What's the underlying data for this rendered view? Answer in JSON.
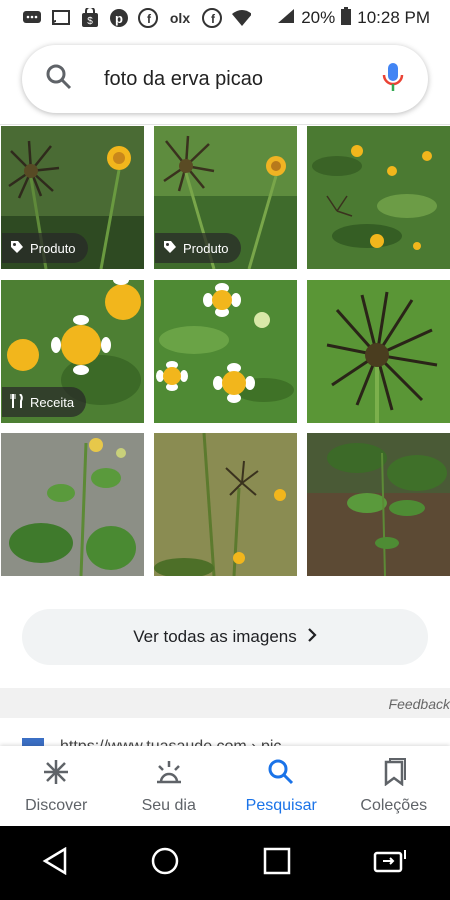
{
  "status_bar": {
    "battery": "20%",
    "time": "10:28 PM",
    "left_icons": [
      "chat-icon",
      "cast-icon",
      "shopping-bag-icon",
      "pinterest-icon",
      "facebook-icon",
      "olx-icon",
      "facebook-icon",
      "wifi-icon"
    ],
    "olx_text": "olx"
  },
  "search": {
    "query": "foto da erva picao",
    "search_icon": "search-icon",
    "mic_icon": "mic-icon"
  },
  "images": {
    "badges": {
      "produto": "Produto",
      "receita": "Receita"
    }
  },
  "more_button": {
    "label": "Ver todas as imagens"
  },
  "feedback": "Feedback",
  "partial_result": "https://www.tuasaude.com › pic",
  "bottom_nav": [
    {
      "label": "Discover",
      "icon": "asterisk-icon",
      "active": false
    },
    {
      "label": "Seu dia",
      "icon": "sunrise-icon",
      "active": false
    },
    {
      "label": "Pesquisar",
      "icon": "search-icon",
      "active": true
    },
    {
      "label": "Coleções",
      "icon": "bookmarks-icon",
      "active": false
    }
  ],
  "colors": {
    "accent": "#1a73e8",
    "plant_green": "#4f7d2e",
    "flower_yellow": "#f2b61c"
  }
}
